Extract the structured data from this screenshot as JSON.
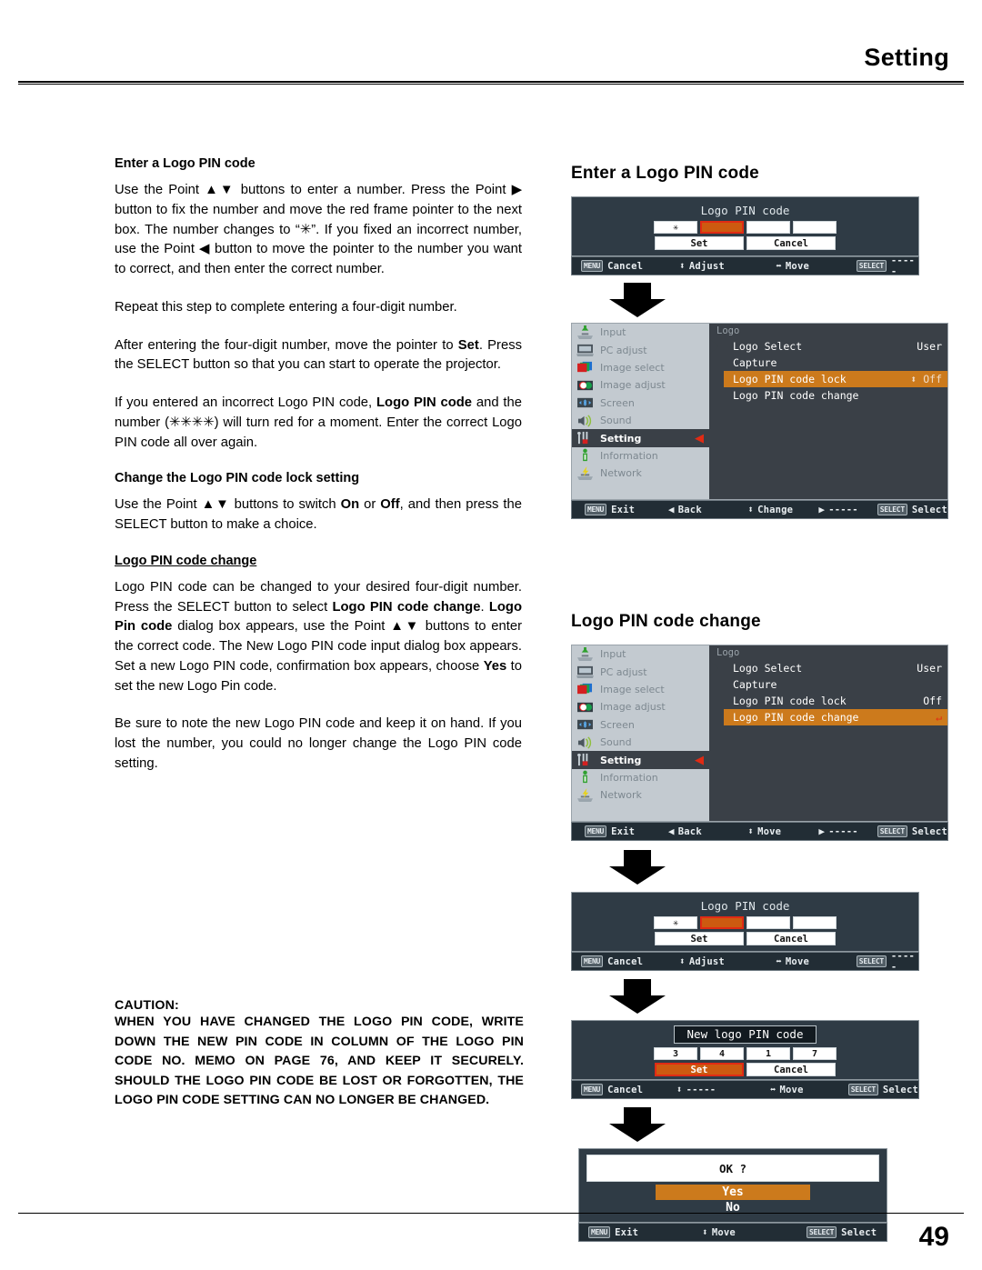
{
  "header": {
    "title": "Setting"
  },
  "footer": {
    "page_number": "49"
  },
  "left_column": {
    "section1_heading": "Enter a Logo PIN code",
    "para1": "Use the Point ▲▼ buttons to enter a number. Press the Point ▶ button to fix the number and move the red frame pointer to the next box. The number changes to “✳”. If you fixed an incorrect number, use the Point ◀ button to move the pointer to the number you want to correct, and then enter the correct number.",
    "para2": "Repeat this step to complete entering a four-digit number.",
    "para3_a": "After entering the four-digit number, move the pointer to ",
    "para3_b": "Set",
    "para3_c": ". Press the SELECT button so that you can start to operate the projector.",
    "para4_a": "If you entered an incorrect Logo PIN code, ",
    "para4_b": "Logo PIN code",
    "para4_c": " and the number (✳✳✳✳) will turn red for a moment. Enter the correct Logo PIN code all over again.",
    "section2_heading": "Change the Logo PIN code lock setting",
    "para5_a": "Use the Point ▲▼ buttons to switch ",
    "para5_b": "On",
    "para5_c": " or ",
    "para5_d": "Off",
    "para5_e": ", and then press the SELECT button to make a choice.",
    "section3_heading": "Logo PIN code change",
    "para6_a": "Logo PIN code can be changed to your desired four-digit number. Press the SELECT button to select ",
    "para6_b": "Logo PIN code change",
    "para6_c": ". ",
    "para6_d": "Logo Pin code",
    "para6_e": " dialog box appears, use the Point ▲▼ buttons to enter the correct code. The New Logo PIN code input dialog box appears. Set a new Logo PIN code, confirmation box appears, choose ",
    "para6_f": "Yes",
    "para6_g": " to set the new Logo Pin code.",
    "para7": "Be sure to note the new Logo PIN code and keep it on hand. If you lost the number, you could no longer change the Logo PIN code setting.",
    "caution_title": "CAUTION:",
    "caution_body": "WHEN YOU HAVE CHANGED THE LOGO PIN CODE, WRITE DOWN THE NEW PIN CODE IN COLUMN OF THE LOGO PIN CODE NO. MEMO ON PAGE 76, AND KEEP IT SECURELY. SHOULD THE LOGO PIN CODE BE LOST OR FORGOTTEN, THE LOGO PIN CODE SETTING CAN NO LONGER BE CHANGED."
  },
  "right_column": {
    "heading1": "Enter a Logo PIN code",
    "heading2": "Logo PIN code change"
  },
  "pin_dialog_1": {
    "title": "Logo PIN code",
    "cells": [
      "✳",
      "",
      "",
      ""
    ],
    "active_index": 1,
    "set_label": "Set",
    "cancel_label": "Cancel",
    "bar": {
      "menu_key": "MENU",
      "menu_action": "Cancel",
      "updown_glyph": "⬍",
      "updown_action": "Adjust",
      "leftright_glyph": "⬌",
      "leftright_action": "Move",
      "select_key": "SELECT",
      "select_action": "-----"
    }
  },
  "menu_1": {
    "sidebar": [
      {
        "label": "Input",
        "icon": "input-icon"
      },
      {
        "label": "PC adjust",
        "icon": "pc-adjust-icon"
      },
      {
        "label": "Image select",
        "icon": "image-select-icon"
      },
      {
        "label": "Image adjust",
        "icon": "image-adjust-icon"
      },
      {
        "label": "Screen",
        "icon": "screen-icon"
      },
      {
        "label": "Sound",
        "icon": "sound-icon"
      },
      {
        "label": "Setting",
        "icon": "setting-icon"
      },
      {
        "label": "Information",
        "icon": "information-icon"
      },
      {
        "label": "Network",
        "icon": "network-icon"
      }
    ],
    "selected_index": 6,
    "panel_title": "Logo",
    "rows": [
      {
        "label": "Logo Select",
        "value": "User",
        "highlight": false
      },
      {
        "label": "Capture",
        "value": "",
        "highlight": false
      },
      {
        "label": "Logo PIN code lock",
        "value": "⬍ Off",
        "highlight": true
      },
      {
        "label": "Logo PIN code change",
        "value": "",
        "highlight": false
      }
    ],
    "bar": {
      "menu_key": "MENU",
      "menu_action": "Exit",
      "back_glyph": "◀",
      "back_action": "Back",
      "updown_glyph": "⬍",
      "updown_action": "Change",
      "right_glyph": "▶",
      "right_action": "-----",
      "select_key": "SELECT",
      "select_action": "Select"
    }
  },
  "menu_2": {
    "sidebar": [
      {
        "label": "Input",
        "icon": "input-icon"
      },
      {
        "label": "PC adjust",
        "icon": "pc-adjust-icon"
      },
      {
        "label": "Image select",
        "icon": "image-select-icon"
      },
      {
        "label": "Image adjust",
        "icon": "image-adjust-icon"
      },
      {
        "label": "Screen",
        "icon": "screen-icon"
      },
      {
        "label": "Sound",
        "icon": "sound-icon"
      },
      {
        "label": "Setting",
        "icon": "setting-icon"
      },
      {
        "label": "Information",
        "icon": "information-icon"
      },
      {
        "label": "Network",
        "icon": "network-icon"
      }
    ],
    "selected_index": 6,
    "panel_title": "Logo",
    "rows": [
      {
        "label": "Logo Select",
        "value": "User",
        "highlight": false
      },
      {
        "label": "Capture",
        "value": "",
        "highlight": false
      },
      {
        "label": "Logo PIN code lock",
        "value": "Off",
        "highlight": false
      },
      {
        "label": "Logo PIN code change",
        "value": "↵",
        "highlight": true
      }
    ],
    "bar": {
      "menu_key": "MENU",
      "menu_action": "Exit",
      "back_glyph": "◀",
      "back_action": "Back",
      "updown_glyph": "⬍",
      "updown_action": "Move",
      "right_glyph": "▶",
      "right_action": "-----",
      "select_key": "SELECT",
      "select_action": "Select"
    }
  },
  "pin_dialog_2": {
    "title": "Logo PIN code",
    "cells": [
      "✳",
      "",
      "",
      ""
    ],
    "active_index": 1,
    "set_label": "Set",
    "cancel_label": "Cancel",
    "bar": {
      "menu_key": "MENU",
      "menu_action": "Cancel",
      "updown_glyph": "⬍",
      "updown_action": "Adjust",
      "leftright_glyph": "⬌",
      "leftright_action": "Move",
      "select_key": "SELECT",
      "select_action": "-----"
    }
  },
  "pin_dialog_3": {
    "title": "New logo PIN code",
    "cells": [
      "3",
      "4",
      "1",
      "7"
    ],
    "active_index": -1,
    "set_label": "Set",
    "cancel_label": "Cancel",
    "set_active": true,
    "bar": {
      "menu_key": "MENU",
      "menu_action": "Cancel",
      "updown_glyph": "⬍",
      "updown_action": "-----",
      "leftright_glyph": "⬌",
      "leftright_action": "Move",
      "select_key": "SELECT",
      "select_action": "Select"
    }
  },
  "confirm_dialog": {
    "question": "OK ?",
    "yes_label": "Yes",
    "no_label": "No",
    "bar": {
      "menu_key": "MENU",
      "menu_action": "Exit",
      "updown_glyph": "⬍",
      "updown_action": "Move",
      "select_key": "SELECT",
      "select_action": "Select"
    }
  },
  "colors": {
    "highlight_orange": "#cc7a1c",
    "active_orange": "#cc5a10",
    "red_frame": "#e02b14",
    "osd_dark": "#2f3b45",
    "menu_panel": "#3a4047",
    "sidebar_gray": "#c3cad0"
  }
}
